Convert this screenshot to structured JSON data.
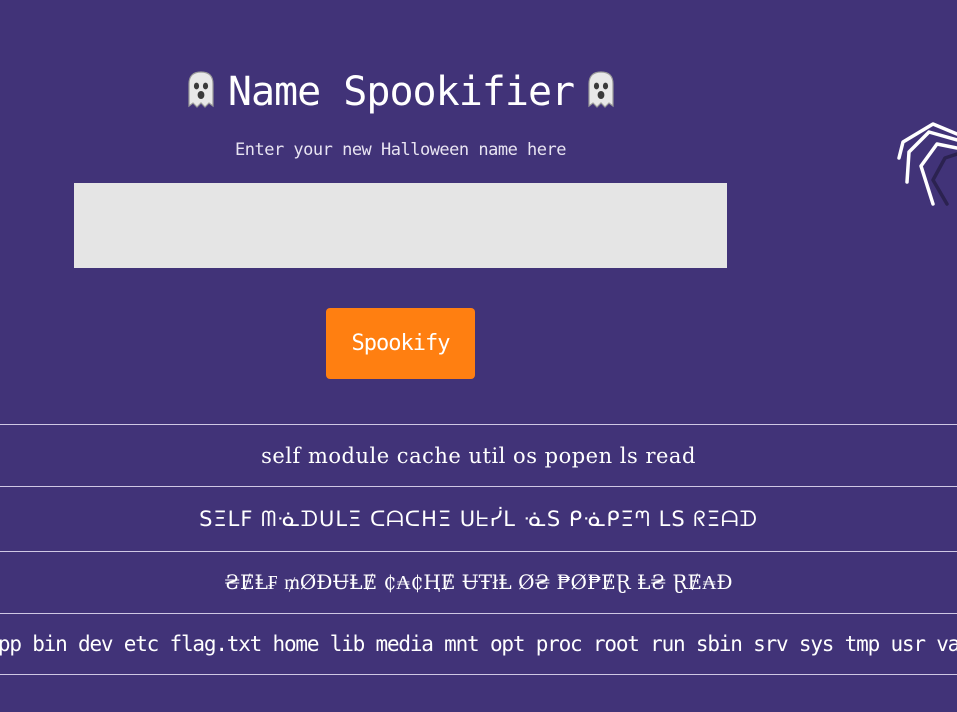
{
  "header": {
    "title": "Name Spookifier",
    "left_icon": "ghost-icon",
    "right_icon": "ghost-icon"
  },
  "form": {
    "subtitle": "Enter your new Halloween name here",
    "input_value": "",
    "input_placeholder": "",
    "button_label": "Spookify"
  },
  "decoration": {
    "icon": "spider-icon"
  },
  "results": [
    "self module cache util os popen ls read",
    "SΞLF ᗰᓍᗪᑌᒪΞ ᑕᗩᑕᕼΞ ᑌᖶᓰᒪ ᓍS ᑭᓍᑭΞᘉ ᒪS ᖇΞᗩᗪ",
    "₴ɆⱠ₣ ₥ØĐɄⱠɆ ₵₳₵ⱧɆ ɄŦłⱠ Ø₴ ₱Ø₱ɆⱤ Ⱡ₴ ⱤɆ₳Đ",
    "app bin dev etc flag.txt home lib media mnt opt proc root run sbin srv sys tmp usr var"
  ],
  "colors": {
    "background": "#413378",
    "input_background": "#e5e5e5",
    "button": "#ff7f11",
    "text": "#ffffff",
    "divider": "#cfc8e4"
  }
}
